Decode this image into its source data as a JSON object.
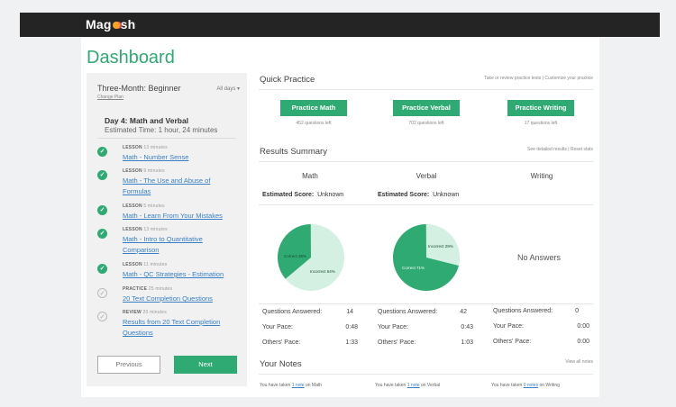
{
  "app": {
    "logo": "Magoosh"
  },
  "page": {
    "title": "Dashboard"
  },
  "plan": {
    "name": "Three-Month: Beginner",
    "days_menu": "All days ▾",
    "change_plan": "Change Plan",
    "day_title": "Day 4: Math and Verbal",
    "estimated_time": "Estimated Time: 1 hour, 24 minutes",
    "items": [
      {
        "kind": "LESSON",
        "duration": "13 minutes",
        "title": "Math - Number Sense",
        "done": true
      },
      {
        "kind": "LESSON",
        "duration": "9 minutes",
        "title": "Math - The Use and Abuse of Formulas",
        "done": true
      },
      {
        "kind": "LESSON",
        "duration": "5 minutes",
        "title": "Math - Learn From Your Mistakes",
        "done": true
      },
      {
        "kind": "LESSON",
        "duration": "13 minutes",
        "title": "Math - Intro to Quantitative Comparison",
        "done": true
      },
      {
        "kind": "LESSON",
        "duration": "11 minutes",
        "title": "Math - QC Strategies - Estimation",
        "done": true
      },
      {
        "kind": "PRACTICE",
        "duration": "25 minutes",
        "title": "20 Text Completion Questions",
        "done": false
      },
      {
        "kind": "REVIEW",
        "duration": "20 minutes",
        "title": "Results from 20 Text Completion Questions",
        "done": false
      }
    ],
    "prev_label": "Previous",
    "next_label": "Next"
  },
  "quick_practice": {
    "heading": "Quick Practice",
    "links": "Take or review practice tests | Customize your practice",
    "buttons": [
      {
        "label": "Practice Math",
        "left": "452 questions left"
      },
      {
        "label": "Practice Verbal",
        "left": "702 questions left"
      },
      {
        "label": "Practice Writing",
        "left": "17 questions left"
      }
    ]
  },
  "results": {
    "heading": "Results Summary",
    "links": "See detailed results | Reset stats",
    "estimated_label": "Estimated Score:",
    "columns": [
      {
        "name": "Math",
        "score": "Unknown",
        "correct_label": "Correct 36%",
        "incorrect_label": "Incorrect 64%",
        "correct_fraction": 0.36,
        "answered": "14",
        "pace": "0:48",
        "others_pace": "1:33"
      },
      {
        "name": "Verbal",
        "score": "Unknown",
        "correct_label": "Correct 71%",
        "incorrect_label": "Incorrect 29%",
        "correct_fraction": 0.71,
        "answered": "42",
        "pace": "0:43",
        "others_pace": "1:03"
      },
      {
        "name": "Writing",
        "no_answers": "No Answers",
        "answered": "0",
        "pace": "0:00",
        "others_pace": "0:00"
      }
    ],
    "labels": {
      "answered": "Questions Answered:",
      "pace": "Your Pace:",
      "others": "Others' Pace:"
    }
  },
  "notes": {
    "heading": "Your Notes",
    "view_all": "View all notes",
    "prefix": "You have taken",
    "items": [
      {
        "count": "1 note",
        "subject": "on Math"
      },
      {
        "count": "1 note",
        "subject": "on Verbal"
      },
      {
        "count": "0 notes",
        "subject": "on Writing"
      }
    ]
  },
  "colors": {
    "accent": "#2eaa72",
    "pie_light": "#d4f0e2",
    "link": "#3a7fc4"
  }
}
